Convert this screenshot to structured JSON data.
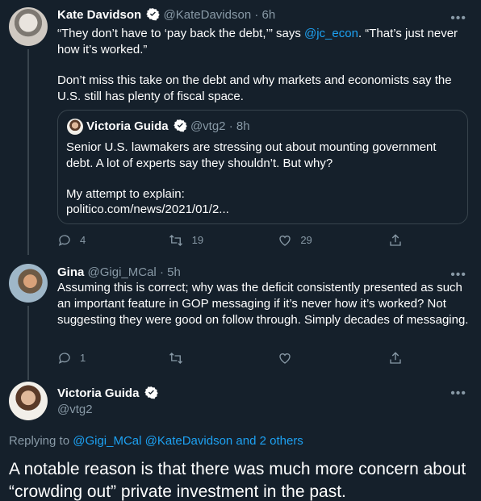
{
  "tweet1": {
    "name": "Kate Davidson",
    "handle": "@KateDavidson",
    "time": "6h",
    "text_before": "“They don’t have to ‘pay back the debt,’” says ",
    "mention": "@jc_econ",
    "text_after": ". “That’s just never how it’s worked.”",
    "text2": "Don’t miss this take on the debt and why markets and economists say the U.S. still has plenty of fiscal space.",
    "quote": {
      "name": "Victoria Guida",
      "handle": "@vtg2",
      "time": "8h",
      "text1": "Senior U.S. lawmakers are stressing out about mounting government debt. A lot of experts say they shouldn’t. But why?",
      "text2": "My attempt to explain:",
      "link": "politico.com/news/2021/01/2..."
    },
    "replies": "4",
    "retweets": "19",
    "likes": "29"
  },
  "tweet2": {
    "name": "Gina",
    "handle": "@Gigi_MCal",
    "time": "5h",
    "text": "Assuming this is correct; why was the deficit consistently presented as such an important feature in GOP messaging if it’s never how it’s worked? Not suggesting they were good on follow through. Simply decades of messaging.",
    "replies": "1",
    "retweets": "",
    "likes": ""
  },
  "main_tweet": {
    "name": "Victoria Guida",
    "handle": "@vtg2",
    "replying_label": "Replying to",
    "replying_to": "@Gigi_MCal @KateDavidson and 2 others",
    "text": "A notable reason is that there was much more concern about “crowding out” private investment in the past."
  },
  "icons": {
    "reply": "reply-icon",
    "retweet": "retweet-icon",
    "like": "like-icon",
    "share": "share-icon",
    "verified": "verified-badge-icon",
    "more": "more-icon"
  },
  "colors": {
    "background": "#15202b",
    "muted": "#8899a6",
    "link": "#1da1f2",
    "border": "#38444d"
  }
}
